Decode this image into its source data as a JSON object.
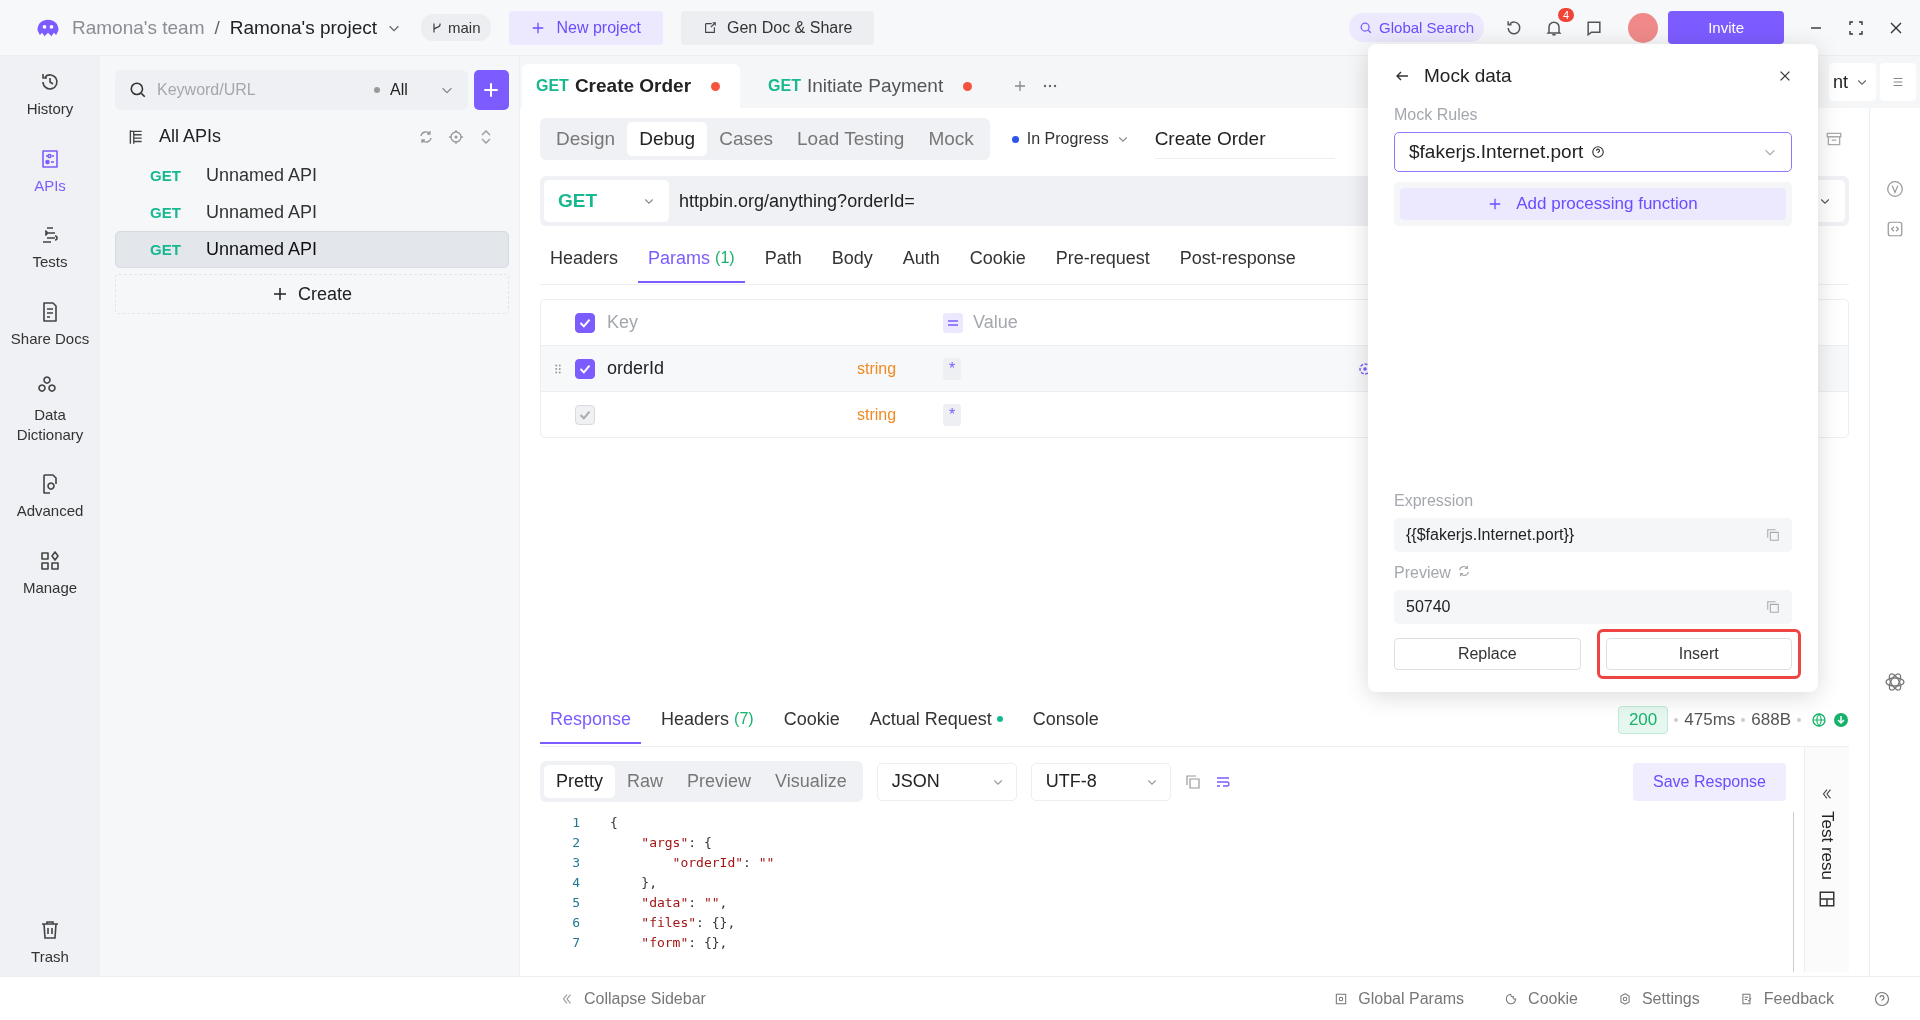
{
  "header": {
    "team": "Ramona's team",
    "separator": "/",
    "project": "Ramona's project",
    "branch": "main",
    "new_project": "New project",
    "gen_doc": "Gen Doc & Share",
    "global_search": "Global Search",
    "notifications": "4",
    "invite": "Invite"
  },
  "rail": [
    {
      "label": "History",
      "kind": "history",
      "selected": false
    },
    {
      "label": "APIs",
      "kind": "apis",
      "selected": true
    },
    {
      "label": "Tests",
      "kind": "tests",
      "selected": false
    },
    {
      "label": "Share Docs",
      "kind": "docs",
      "selected": false
    },
    {
      "label": "Data Dictionary",
      "kind": "dictionary",
      "selected": false
    },
    {
      "label": "Advanced",
      "kind": "advanced",
      "selected": false
    },
    {
      "label": "Manage",
      "kind": "manage",
      "selected": false
    }
  ],
  "rail_bottom": {
    "label": "Trash",
    "kind": "trash",
    "selected": false
  },
  "api_list": {
    "placeholder": "Keyword/URL",
    "filter": "All",
    "root": "All APIs",
    "create": "Create",
    "items": [
      {
        "method": "GET",
        "name": "Unnamed API",
        "selected": false
      },
      {
        "method": "GET",
        "name": "Unnamed API",
        "selected": false
      },
      {
        "method": "GET",
        "name": "Unnamed API",
        "selected": true
      }
    ]
  },
  "tabs": [
    {
      "method": "GET",
      "title": "Create Order",
      "selected": true,
      "unsaved": true
    },
    {
      "method": "GET",
      "title": "Initiate Payment",
      "selected": false,
      "unsaved": true
    }
  ],
  "environment": "nt",
  "modes": [
    {
      "label": "Design",
      "selected": false
    },
    {
      "label": "Debug",
      "selected": true
    },
    {
      "label": "Cases",
      "selected": false
    },
    {
      "label": "Load Testing",
      "selected": false
    },
    {
      "label": "Mock",
      "selected": false
    }
  ],
  "api_status": {
    "label": "In Progress",
    "color": "#2f54eb"
  },
  "api_name": "Create Order",
  "request": {
    "method": "GET",
    "url": "httpbin.org/anything?orderId="
  },
  "request_tabs": [
    {
      "label": "Headers",
      "selected": false
    },
    {
      "label": "Params",
      "count": "(1)",
      "selected": true
    },
    {
      "label": "Path",
      "selected": false
    },
    {
      "label": "Body",
      "selected": false
    },
    {
      "label": "Auth",
      "selected": false
    },
    {
      "label": "Cookie",
      "selected": false
    },
    {
      "label": "Pre-request",
      "selected": false
    },
    {
      "label": "Post-response",
      "selected": false
    }
  ],
  "params": {
    "all_checked": true,
    "key_header": "Key",
    "value_header": "Value",
    "rows": [
      {
        "key": "orderId",
        "type": "string",
        "value_mark": "*",
        "checked": true,
        "disabled": false
      },
      {
        "type": "string",
        "value_mark": "*",
        "checked": true,
        "disabled": true
      }
    ]
  },
  "mock_panel": {
    "title": "Mock data",
    "rules_label": "Mock Rules",
    "rule": "$fakerjs.Internet.port",
    "add_function": "Add processing function",
    "expression_label": "Expression",
    "expression": "{{$fakerjs.Internet.port}}",
    "preview_label": "Preview",
    "preview": "50740",
    "buttons": [
      {
        "label": "Replace",
        "highlighted": false
      },
      {
        "label": "Insert",
        "highlighted": true
      }
    ]
  },
  "response": {
    "tabs": [
      {
        "label": "Response",
        "selected": true
      },
      {
        "label": "Headers",
        "count": "(7)",
        "selected": false
      },
      {
        "label": "Cookie",
        "selected": false
      },
      {
        "label": "Actual Request",
        "dot": true,
        "selected": false
      },
      {
        "label": "Console",
        "selected": false
      }
    ],
    "status_code": "200",
    "time": "475ms",
    "size": "688B",
    "views": [
      {
        "label": "Pretty",
        "selected": true
      },
      {
        "label": "Raw",
        "selected": false
      },
      {
        "label": "Preview",
        "selected": false
      },
      {
        "label": "Visualize",
        "selected": false
      }
    ],
    "format": "JSON",
    "encoding": "UTF-8",
    "save": "Save Response",
    "side_panel": "Test resu",
    "lines": [
      {
        "num": "1",
        "parts": [
          {
            "text": "{",
            "kind": "punct"
          }
        ]
      },
      {
        "num": "2",
        "parts": [
          {
            "text": "    \"args\"",
            "kind": "key"
          },
          {
            "text": ": {",
            "kind": "punct"
          }
        ]
      },
      {
        "num": "3",
        "parts": [
          {
            "text": "        \"orderId\"",
            "kind": "key"
          },
          {
            "text": ": ",
            "kind": "punct"
          },
          {
            "text": "\"\"",
            "kind": "string"
          }
        ]
      },
      {
        "num": "4",
        "parts": [
          {
            "text": "    },",
            "kind": "punct"
          }
        ]
      },
      {
        "num": "5",
        "parts": [
          {
            "text": "    \"data\"",
            "kind": "key"
          },
          {
            "text": ": ",
            "kind": "punct"
          },
          {
            "text": "\"\"",
            "kind": "string"
          },
          {
            "text": ",",
            "kind": "punct"
          }
        ]
      },
      {
        "num": "6",
        "parts": [
          {
            "text": "    \"files\"",
            "kind": "key"
          },
          {
            "text": ": {},",
            "kind": "punct"
          }
        ]
      },
      {
        "num": "7",
        "parts": [
          {
            "text": "    \"form\"",
            "kind": "key"
          },
          {
            "text": ": {},",
            "kind": "punct"
          }
        ]
      }
    ]
  },
  "footer": {
    "collapse": "Collapse Sidebar",
    "items": [
      {
        "label": "Global Params",
        "kind": "params"
      },
      {
        "label": "Cookie",
        "kind": "cookie"
      },
      {
        "label": "Settings",
        "kind": "settings"
      },
      {
        "label": "Feedback",
        "kind": "feedback"
      }
    ]
  }
}
